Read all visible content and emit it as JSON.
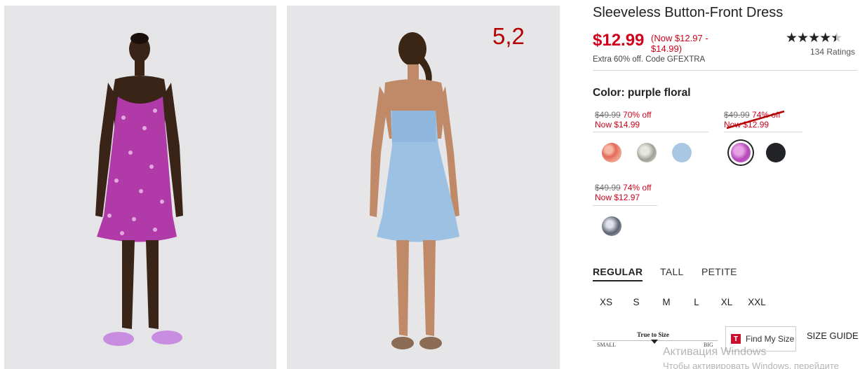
{
  "product": {
    "title": "Sleeveless Button-Front Dress",
    "price": "$12.99",
    "price_range": "(Now $12.97 - $14.99)",
    "promo": "Extra 60% off. Code GFEXTRA",
    "rating_stars": "★★★★★",
    "rating_value": 4.5,
    "ratings_count": "134 Ratings"
  },
  "annotation": "5,2",
  "color": {
    "label": "Color: purple floral"
  },
  "price_groups": [
    {
      "was": "$49.99",
      "off": "70% off",
      "now": "Now $14.99",
      "struck": false
    },
    {
      "was": "$49.99",
      "off": "74% off",
      "now": "Now $12.99",
      "struck": true
    },
    {
      "was": "$49.99",
      "off": "74% off",
      "now": "Now $12.97",
      "struck": false
    }
  ],
  "swatches": [
    {
      "name": "red floral",
      "color": "#e8836f"
    },
    {
      "name": "green floral",
      "color": "#b9bcb0"
    },
    {
      "name": "chambray",
      "color": "#a9c7e3"
    },
    {
      "name": "purple floral",
      "color": "#b347b8",
      "selected": true
    },
    {
      "name": "black",
      "color": "#222427"
    },
    {
      "name": "navy print",
      "color": "#8d939e"
    }
  ],
  "fit_tabs": [
    "REGULAR",
    "TALL",
    "PETITE"
  ],
  "sizes": [
    "XS",
    "S",
    "M",
    "L",
    "XL",
    "XXL"
  ],
  "fit_meter": {
    "label": "True to Size",
    "small": "SMALL",
    "big": "BIG",
    "level": 0.5
  },
  "find_my_size": {
    "logo": "T",
    "label": "Find My Size"
  },
  "size_guide": "SIZE GUIDE",
  "watermark": {
    "line1": "Активация Windows",
    "line2": "Чтобы активировать Windows, перейдите"
  },
  "colors": {
    "accent": "#d0021b",
    "text": "#222222"
  }
}
